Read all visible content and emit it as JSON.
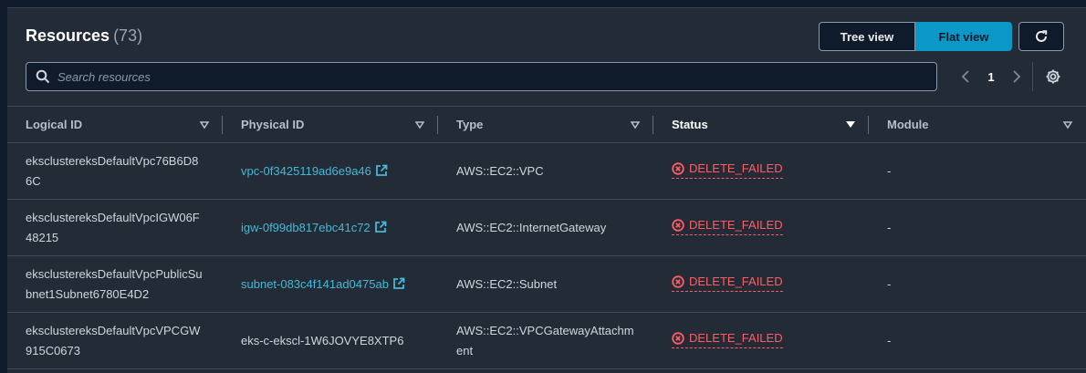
{
  "header": {
    "title": "Resources",
    "count": "(73)",
    "tree_view_label": "Tree view",
    "flat_view_label": "Flat view"
  },
  "search": {
    "placeholder": "Search resources",
    "value": ""
  },
  "pagination": {
    "current_page": "1"
  },
  "table": {
    "columns": [
      "Logical ID",
      "Physical ID",
      "Type",
      "Status",
      "Module"
    ],
    "rows": [
      {
        "logical_id": "eksclustereksDefaultVpc76B6D86C",
        "physical_id": "vpc-0f3425119ad6e9a46",
        "type": "AWS::EC2::VPC",
        "status": "DELETE_FAILED",
        "module": "-"
      },
      {
        "logical_id": "eksclustereksDefaultVpcIGW06F48215",
        "physical_id": "igw-0f99db817ebc41c72",
        "type": "AWS::EC2::InternetGateway",
        "status": "DELETE_FAILED",
        "module": "-"
      },
      {
        "logical_id": "eksclustereksDefaultVpcPublicSubnet1Subnet6780E4D2",
        "physical_id": "subnet-083c4f141ad0475ab",
        "type": "AWS::EC2::Subnet",
        "status": "DELETE_FAILED",
        "module": "-"
      },
      {
        "logical_id": "eksclustereksDefaultVpcVPCGW915C0673",
        "physical_id": "eks-c-ekscl-1W6JOVYE8XTP6",
        "type": "AWS::EC2::VPCGatewayAttachment",
        "status": "DELETE_FAILED",
        "module": "-"
      }
    ]
  },
  "colors": {
    "panel_bg": "#232b37",
    "accent": "#0b98c6",
    "link": "#44b9d6",
    "error": "#ff5d64"
  },
  "icons": [
    "refresh-icon",
    "search-icon",
    "chevron-left-icon",
    "chevron-right-icon",
    "settings-icon",
    "sort-caret-icon",
    "external-link-icon",
    "error-circle-icon"
  ]
}
